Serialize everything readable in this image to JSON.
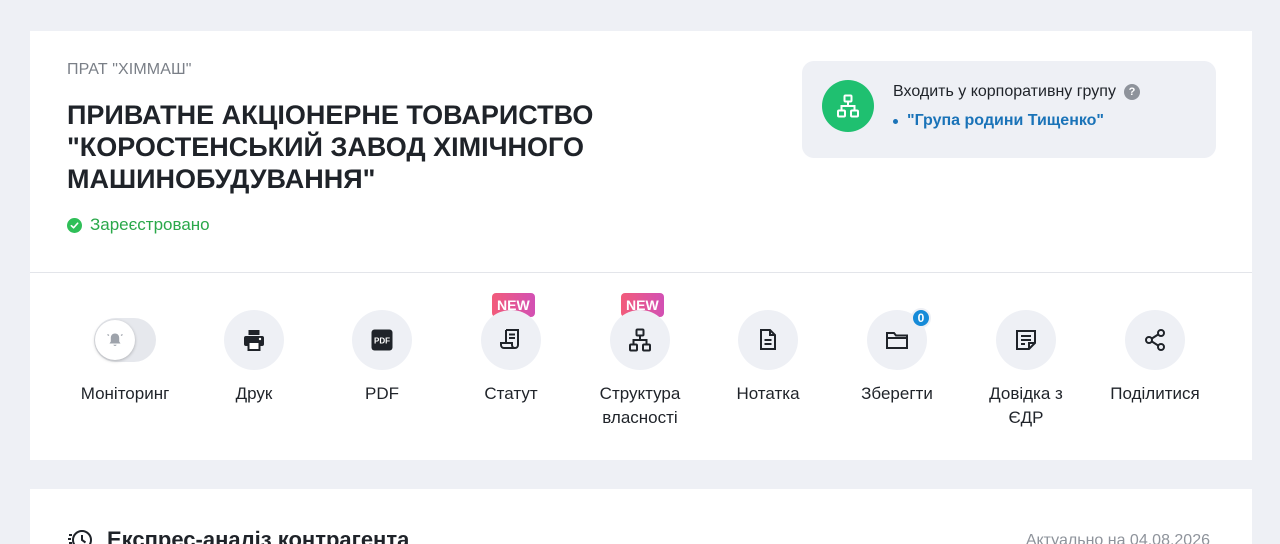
{
  "company": {
    "short_name": "ПРАТ \"ХІММАШ\"",
    "full_name": "ПРИВАТНЕ АКЦІОНЕРНЕ ТОВАРИСТВО \"КОРОСТЕНСЬКИЙ ЗАВОД ХІМІЧНОГО МАШИНОБУДУВАННЯ\"",
    "status": "Зареєстровано"
  },
  "group": {
    "title": "Входить у корпоративну групу",
    "help": "?",
    "link": "\"Група родини Тищенко\""
  },
  "actions": [
    {
      "label": "Моніторинг",
      "icon": "bell-icon",
      "type": "toggle"
    },
    {
      "label": "Друк",
      "icon": "printer-icon"
    },
    {
      "label": "PDF",
      "icon": "pdf-icon",
      "icon_text": "PDF"
    },
    {
      "label": "Статут",
      "icon": "scroll-icon",
      "badge": "NEW"
    },
    {
      "label": "Структура власності",
      "icon": "hierarchy-icon",
      "badge": "NEW"
    },
    {
      "label": "Нотатка",
      "icon": "note-icon"
    },
    {
      "label": "Зберегти",
      "icon": "folder-icon",
      "count": "0"
    },
    {
      "label": "Довідка з ЄДР",
      "icon": "document-icon"
    },
    {
      "label": "Поділитися",
      "icon": "share-icon"
    }
  ],
  "analysis": {
    "title": "Експрес-аналіз контрагента",
    "actual": "Актуально на 04.08.2026"
  },
  "colors": {
    "accent_green": "#1fc070",
    "status_green": "#2aa84a",
    "link_blue": "#1a73b8",
    "badge_gradient_start": "#f25b7a",
    "badge_gradient_end": "#d250b4"
  }
}
